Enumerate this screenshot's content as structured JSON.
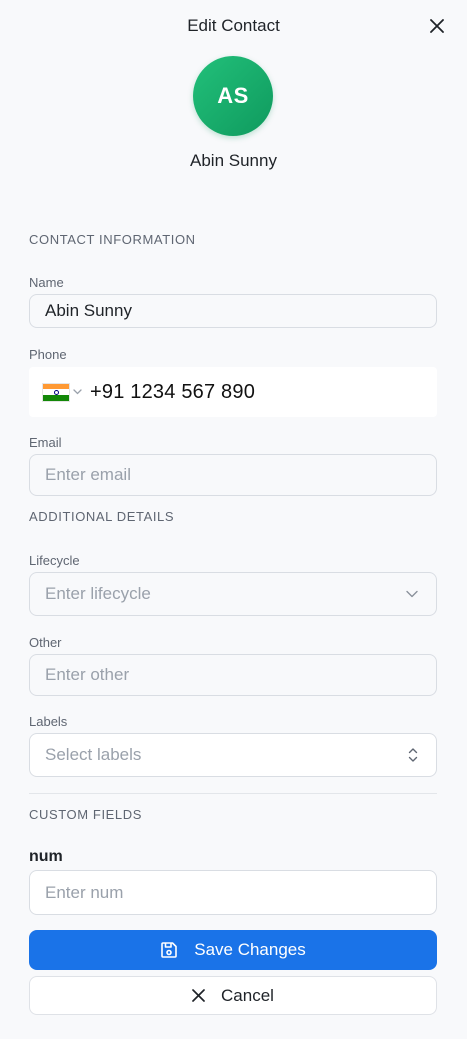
{
  "header": {
    "title": "Edit Contact",
    "close_icon": "close-icon"
  },
  "contact": {
    "initials": "AS",
    "name": "Abin Sunny",
    "avatar_color": "#14a96b"
  },
  "sections": {
    "contact_information": "CONTACT INFORMATION",
    "additional_details": "ADDITIONAL DETAILS",
    "custom_fields": "CUSTOM FIELDS"
  },
  "fields": {
    "name": {
      "label": "Name",
      "value": "Abin Sunny"
    },
    "phone": {
      "label": "Phone",
      "country_flag": "india-flag-icon",
      "value": "+91 1234 567 890"
    },
    "email": {
      "label": "Email",
      "placeholder": "Enter email"
    },
    "lifecycle": {
      "label": "Lifecycle",
      "placeholder": "Enter lifecycle"
    },
    "other": {
      "label": "Other",
      "placeholder": "Enter other"
    },
    "labels": {
      "label": "Labels",
      "placeholder": "Select labels"
    },
    "num": {
      "label": "num",
      "placeholder": "Enter num"
    }
  },
  "actions": {
    "save_label": "Save Changes",
    "save_icon": "save-icon",
    "cancel_label": "Cancel",
    "cancel_icon": "close-icon",
    "primary_color": "#1a73e8"
  }
}
